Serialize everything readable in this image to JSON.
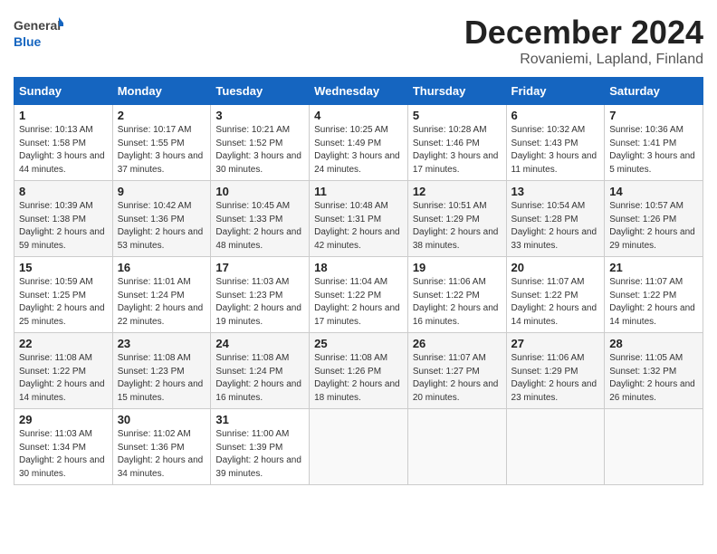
{
  "logo": {
    "general": "General",
    "blue": "Blue"
  },
  "title": "December 2024",
  "location": "Rovaniemi, Lapland, Finland",
  "days_of_week": [
    "Sunday",
    "Monday",
    "Tuesday",
    "Wednesday",
    "Thursday",
    "Friday",
    "Saturday"
  ],
  "weeks": [
    [
      {
        "day": "1",
        "sunrise": "10:13 AM",
        "sunset": "1:58 PM",
        "daylight": "3 hours and 44 minutes."
      },
      {
        "day": "2",
        "sunrise": "10:17 AM",
        "sunset": "1:55 PM",
        "daylight": "3 hours and 37 minutes."
      },
      {
        "day": "3",
        "sunrise": "10:21 AM",
        "sunset": "1:52 PM",
        "daylight": "3 hours and 30 minutes."
      },
      {
        "day": "4",
        "sunrise": "10:25 AM",
        "sunset": "1:49 PM",
        "daylight": "3 hours and 24 minutes."
      },
      {
        "day": "5",
        "sunrise": "10:28 AM",
        "sunset": "1:46 PM",
        "daylight": "3 hours and 17 minutes."
      },
      {
        "day": "6",
        "sunrise": "10:32 AM",
        "sunset": "1:43 PM",
        "daylight": "3 hours and 11 minutes."
      },
      {
        "day": "7",
        "sunrise": "10:36 AM",
        "sunset": "1:41 PM",
        "daylight": "3 hours and 5 minutes."
      }
    ],
    [
      {
        "day": "8",
        "sunrise": "10:39 AM",
        "sunset": "1:38 PM",
        "daylight": "2 hours and 59 minutes."
      },
      {
        "day": "9",
        "sunrise": "10:42 AM",
        "sunset": "1:36 PM",
        "daylight": "2 hours and 53 minutes."
      },
      {
        "day": "10",
        "sunrise": "10:45 AM",
        "sunset": "1:33 PM",
        "daylight": "2 hours and 48 minutes."
      },
      {
        "day": "11",
        "sunrise": "10:48 AM",
        "sunset": "1:31 PM",
        "daylight": "2 hours and 42 minutes."
      },
      {
        "day": "12",
        "sunrise": "10:51 AM",
        "sunset": "1:29 PM",
        "daylight": "2 hours and 38 minutes."
      },
      {
        "day": "13",
        "sunrise": "10:54 AM",
        "sunset": "1:28 PM",
        "daylight": "2 hours and 33 minutes."
      },
      {
        "day": "14",
        "sunrise": "10:57 AM",
        "sunset": "1:26 PM",
        "daylight": "2 hours and 29 minutes."
      }
    ],
    [
      {
        "day": "15",
        "sunrise": "10:59 AM",
        "sunset": "1:25 PM",
        "daylight": "2 hours and 25 minutes."
      },
      {
        "day": "16",
        "sunrise": "11:01 AM",
        "sunset": "1:24 PM",
        "daylight": "2 hours and 22 minutes."
      },
      {
        "day": "17",
        "sunrise": "11:03 AM",
        "sunset": "1:23 PM",
        "daylight": "2 hours and 19 minutes."
      },
      {
        "day": "18",
        "sunrise": "11:04 AM",
        "sunset": "1:22 PM",
        "daylight": "2 hours and 17 minutes."
      },
      {
        "day": "19",
        "sunrise": "11:06 AM",
        "sunset": "1:22 PM",
        "daylight": "2 hours and 16 minutes."
      },
      {
        "day": "20",
        "sunrise": "11:07 AM",
        "sunset": "1:22 PM",
        "daylight": "2 hours and 14 minutes."
      },
      {
        "day": "21",
        "sunrise": "11:07 AM",
        "sunset": "1:22 PM",
        "daylight": "2 hours and 14 minutes."
      }
    ],
    [
      {
        "day": "22",
        "sunrise": "11:08 AM",
        "sunset": "1:22 PM",
        "daylight": "2 hours and 14 minutes."
      },
      {
        "day": "23",
        "sunrise": "11:08 AM",
        "sunset": "1:23 PM",
        "daylight": "2 hours and 15 minutes."
      },
      {
        "day": "24",
        "sunrise": "11:08 AM",
        "sunset": "1:24 PM",
        "daylight": "2 hours and 16 minutes."
      },
      {
        "day": "25",
        "sunrise": "11:08 AM",
        "sunset": "1:26 PM",
        "daylight": "2 hours and 18 minutes."
      },
      {
        "day": "26",
        "sunrise": "11:07 AM",
        "sunset": "1:27 PM",
        "daylight": "2 hours and 20 minutes."
      },
      {
        "day": "27",
        "sunrise": "11:06 AM",
        "sunset": "1:29 PM",
        "daylight": "2 hours and 23 minutes."
      },
      {
        "day": "28",
        "sunrise": "11:05 AM",
        "sunset": "1:32 PM",
        "daylight": "2 hours and 26 minutes."
      }
    ],
    [
      {
        "day": "29",
        "sunrise": "11:03 AM",
        "sunset": "1:34 PM",
        "daylight": "2 hours and 30 minutes."
      },
      {
        "day": "30",
        "sunrise": "11:02 AM",
        "sunset": "1:36 PM",
        "daylight": "2 hours and 34 minutes."
      },
      {
        "day": "31",
        "sunrise": "11:00 AM",
        "sunset": "1:39 PM",
        "daylight": "2 hours and 39 minutes."
      },
      null,
      null,
      null,
      null
    ]
  ],
  "labels": {
    "sunrise": "Sunrise:",
    "sunset": "Sunset:",
    "daylight": "Daylight:"
  }
}
